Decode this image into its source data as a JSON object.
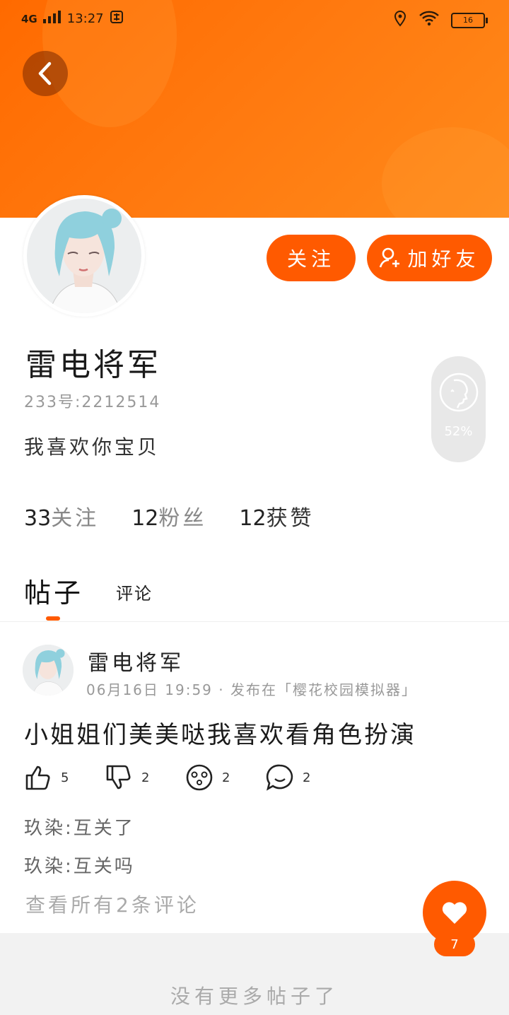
{
  "status_bar": {
    "network": "4G",
    "time": "13:27",
    "battery": "16"
  },
  "profile": {
    "name": "雷电将军",
    "uid": "233号:2212514",
    "bio": "我喜欢你宝贝",
    "follow_button": "关注",
    "add_friend_button": "加好友",
    "similarity": "52%",
    "stats": [
      {
        "count": "33",
        "label": "关注"
      },
      {
        "count": "12",
        "label": "粉丝"
      },
      {
        "count": "12",
        "label": "获赞"
      }
    ]
  },
  "tabs": {
    "active": "帖子",
    "other": "评论"
  },
  "post": {
    "author": "雷电将军",
    "meta": "06月16日 19:59 · 发布在「樱花校园模拟器」",
    "text": "小姐姐们美美哒我喜欢看角色扮演",
    "likes": "5",
    "dislikes": "2",
    "emoji_count": "2",
    "comment_count": "2",
    "comments": [
      "玖染:互关了",
      "玖染:互关吗"
    ],
    "view_all": "查看所有2条评论"
  },
  "footer": {
    "text": "没有更多帖子了"
  },
  "fab": {
    "count": "7"
  },
  "colors": {
    "accent": "#ff5a00",
    "header": "#ff6a00"
  }
}
